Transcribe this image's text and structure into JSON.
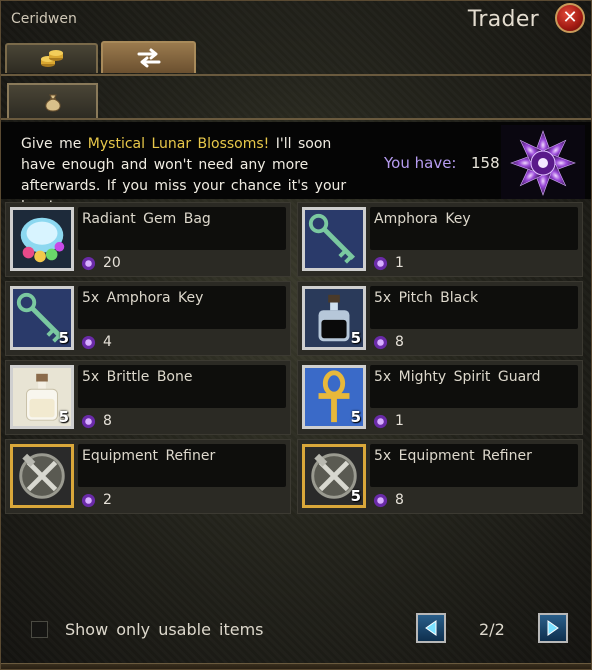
{
  "window": {
    "npc_name": "Ceridwen",
    "title": "Trader",
    "close_symbol": "✕"
  },
  "tabs": [
    {
      "icon": "gold-coins-icon",
      "active": false
    },
    {
      "icon": "swap-arrows-icon",
      "active": true
    }
  ],
  "subtab": {
    "icon": "pouch-icon"
  },
  "quest": {
    "text_before": "Give me ",
    "highlight": "Mystical Lunar Blossoms!",
    "text_after": " I'll soon have enough and won't need any more afterwards. If you miss your chance it's your loss!",
    "you_have_label": "You have:",
    "you_have_count": "158",
    "currency_icon": "lunar-blossom-icon",
    "highlight_color": "#e8c84a",
    "label_color": "#b69cf0"
  },
  "items": [
    {
      "name": "Radiant Gem Bag",
      "price": "20",
      "qty": "",
      "icon": "gem-bag-icon",
      "frame": "silver"
    },
    {
      "name": "Amphora Key",
      "price": "1",
      "qty": "",
      "icon": "key-icon",
      "frame": "silver"
    },
    {
      "name": "5x Amphora Key",
      "price": "4",
      "qty": "5",
      "icon": "key-icon",
      "frame": "silver"
    },
    {
      "name": "5x Pitch Black",
      "price": "8",
      "qty": "5",
      "icon": "black-potion-icon",
      "frame": "silver"
    },
    {
      "name": "5x Brittle Bone",
      "price": "8",
      "qty": "5",
      "icon": "white-potion-icon",
      "frame": "silver"
    },
    {
      "name": "5x Mighty Spirit Guard",
      "price": "1",
      "qty": "5",
      "icon": "ankh-icon",
      "frame": "silver"
    },
    {
      "name": "Equipment Refiner",
      "price": "2",
      "qty": "",
      "icon": "hammer-tongs-icon",
      "frame": "gold"
    },
    {
      "name": "5x Equipment Refiner",
      "price": "8",
      "qty": "5",
      "icon": "hammer-tongs-icon",
      "frame": "gold"
    }
  ],
  "footer": {
    "show_usable_label": "Show only usable items",
    "show_usable_checked": false,
    "page": "2/2"
  }
}
